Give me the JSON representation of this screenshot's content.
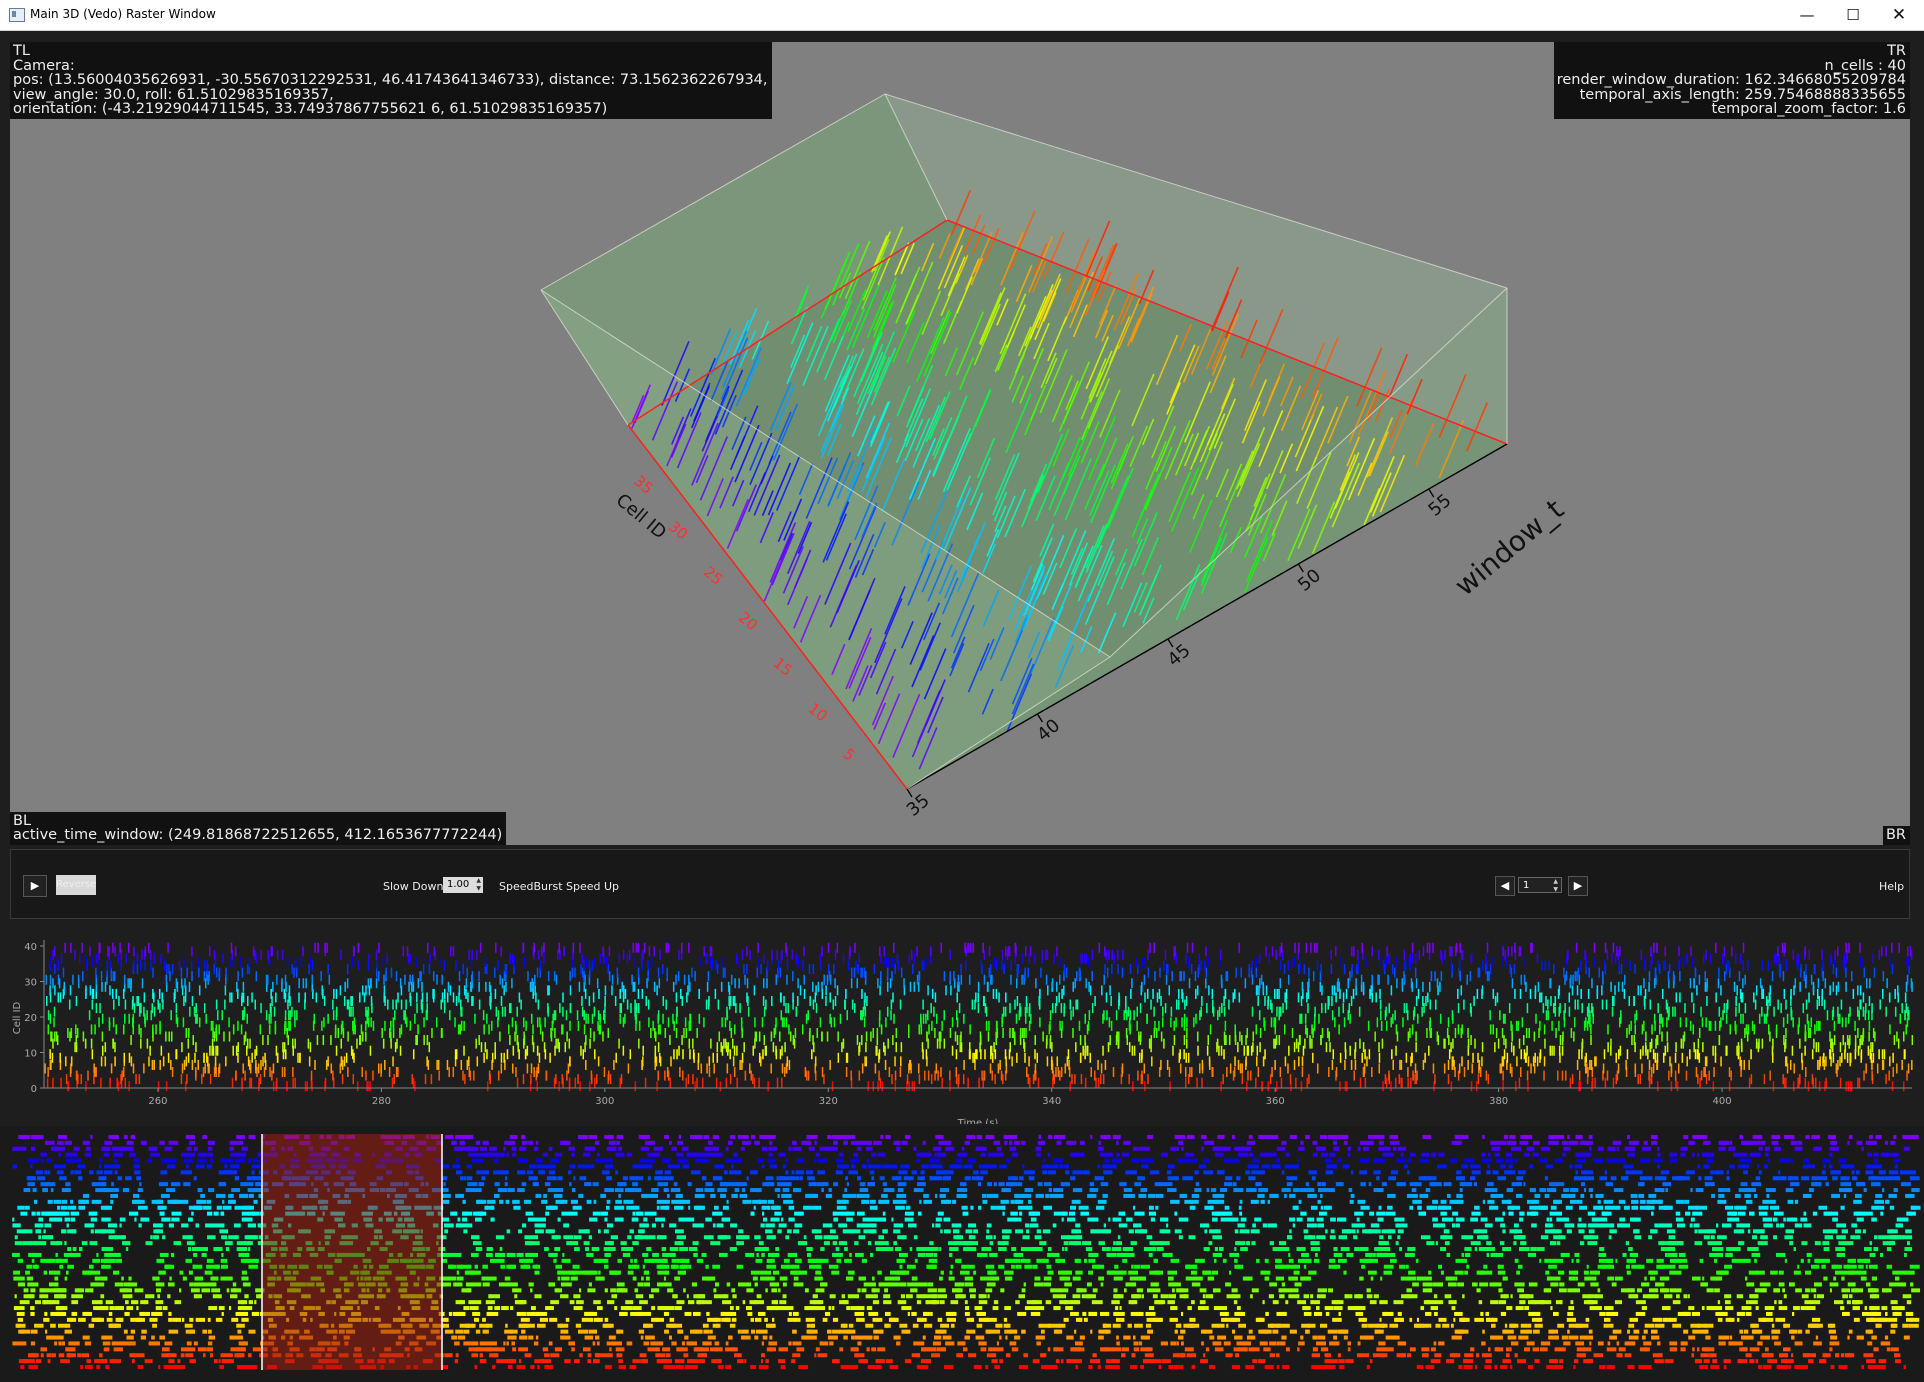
{
  "window": {
    "title": "Main 3D (Vedo) Raster Window",
    "minimize_icon": "minimize-icon",
    "maximize_icon": "maximize-icon",
    "close_icon": "close-icon"
  },
  "viewport": {
    "background": "#808080",
    "corner_tl": "TL\nCamera:\npos: (13.56004035626931, -30.55670312292531, 46.41743641346733), distance: 73.1562362267934,\nview_angle: 30.0, roll: 61.51029835169357,\norientation: (-43.21929044711545, 33.74937867755621 6, 61.51029835169357)",
    "corner_tr": "TR\nn_cells : 40\nrender_window_duration: 162.34668055209784\ntemporal_axis_length: 259.75468888335655\ntemporal_zoom_factor: 1.6",
    "corner_bl": "BL\nactive_time_window: (249.81868722512655, 412.1653677772244)",
    "corner_br": "BR",
    "cell_axis_title": "Cell ID",
    "cell_axis_ticks": [
      "5",
      "10",
      "15",
      "20",
      "25",
      "30",
      "35"
    ],
    "time_axis_title": "window_t",
    "time_axis_ticks": [
      "35",
      "40",
      "45",
      "50",
      "55"
    ]
  },
  "controls": {
    "play_icon": "play-icon",
    "reverse_label": "Reverse",
    "slow_down_label": "Slow Down",
    "speed_value": "1.00",
    "speed_burst_label": "SpeedBurst",
    "speed_up_label": "Speed Up",
    "prev_icon": "step-back-icon",
    "frame_value": "1",
    "next_icon": "step-forward-icon",
    "help_label": "Help"
  },
  "chart_data": [
    {
      "type": "scatter",
      "title": "",
      "ylabel": "Cell ID",
      "xlabel": "Time (s)",
      "xlim": [
        249.8,
        417
      ],
      "ylim": [
        0,
        40
      ],
      "x_ticks": [
        "260",
        "280",
        "300",
        "320",
        "340",
        "360",
        "380",
        "400"
      ],
      "y_ticks": [
        "0",
        "10",
        "20",
        "30",
        "40"
      ],
      "n_cells": 40,
      "color_map": "cell id colored red (low) to violet (high)",
      "grid": false
    },
    {
      "type": "scatter",
      "title": "",
      "description_of_window": "full-session overview raster with highlighted active window",
      "n_cells": 40,
      "highlight_region_color": "#a02010"
    }
  ]
}
